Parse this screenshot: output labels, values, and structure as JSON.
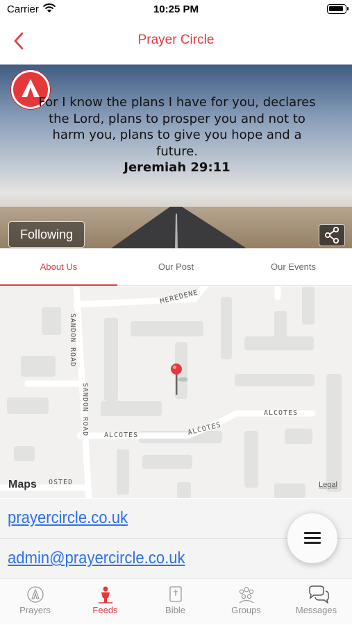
{
  "status_bar": {
    "carrier": "Carrier",
    "time": "10:25 PM"
  },
  "nav": {
    "title": "Prayer Circle",
    "back_icon": "chevron-left-icon"
  },
  "banner": {
    "verse": "For I know the plans I have for you, declares the Lord, plans to prosper you and not to harm you, plans to give you hope and a future.",
    "reference": "Jeremiah 29:11",
    "following_label": "Following",
    "share_icon": "share-icon"
  },
  "tabs": [
    {
      "label": "About Us",
      "active": true
    },
    {
      "label": "Our Post",
      "active": false
    },
    {
      "label": "Our Events",
      "active": false
    }
  ],
  "map": {
    "street_labels": [
      "MEREDENE",
      "SANDON ROAD",
      "SANDON ROAD",
      "ALCOTES",
      "ALCOTES",
      "ALCOTES",
      "OSTED"
    ],
    "attribution": "Maps",
    "legal": "Legal"
  },
  "contact": {
    "website": "prayercircle.co.uk",
    "email": "admin@prayercircle.co.uk"
  },
  "tab_bar": [
    {
      "label": "Prayers",
      "icon": "praying-hands-icon",
      "active": false
    },
    {
      "label": "Feeds",
      "icon": "person-icon",
      "active": true
    },
    {
      "label": "Bible",
      "icon": "bible-icon",
      "active": false
    },
    {
      "label": "Groups",
      "icon": "group-icon",
      "active": false
    },
    {
      "label": "Messages",
      "icon": "chat-bubbles-icon",
      "active": false
    }
  ],
  "colors": {
    "accent": "#e5383b",
    "link": "#2d6ff0"
  }
}
